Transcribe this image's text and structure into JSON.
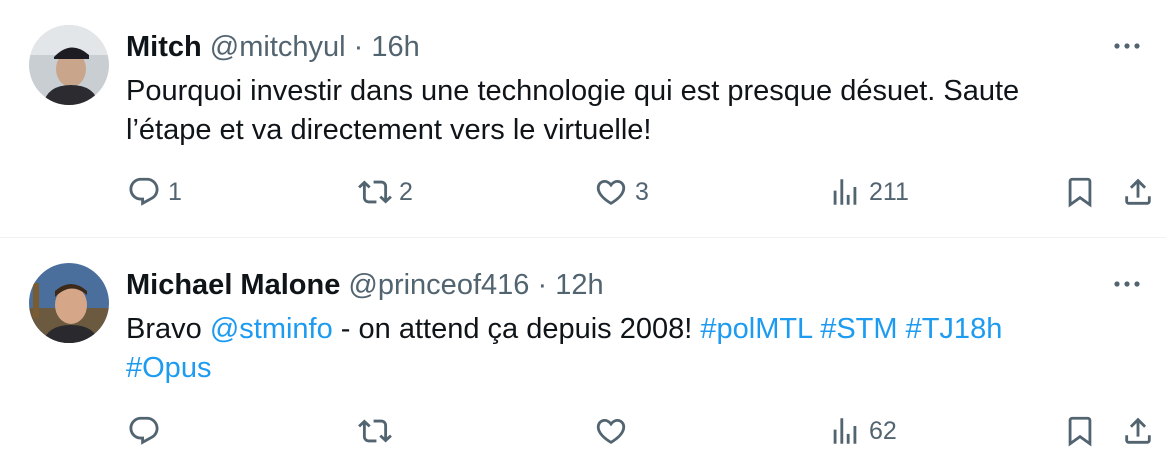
{
  "tweets": [
    {
      "name": "Mitch",
      "handle": "@mitchyul",
      "dot": "·",
      "time": "16h",
      "text_line1": "Pourquoi investir dans une technologie qui est presque désuet. Saute",
      "text_line2": "l’étape et va directement vers le virtuelle!",
      "replies": "1",
      "retweets": "2",
      "likes": "3",
      "views": "211"
    },
    {
      "name": "Michael Malone",
      "handle": "@princeof416",
      "dot": "·",
      "time": "12h",
      "text_part1": "Bravo ",
      "mention": "@stminfo",
      "text_part2": " - on attend ça depuis 2008! ",
      "hashtags": [
        "#polMTL",
        "#STM",
        "#TJ18h"
      ],
      "hashtag_line2": "#Opus",
      "views": "62"
    }
  ],
  "colors": {
    "text": "#0f1419",
    "secondary": "#536471",
    "link": "#1d9bf0",
    "divider": "#eff3f4"
  },
  "icons": [
    "reply-icon",
    "retweet-icon",
    "like-icon",
    "views-icon",
    "bookmark-icon",
    "share-icon",
    "more-icon"
  ]
}
